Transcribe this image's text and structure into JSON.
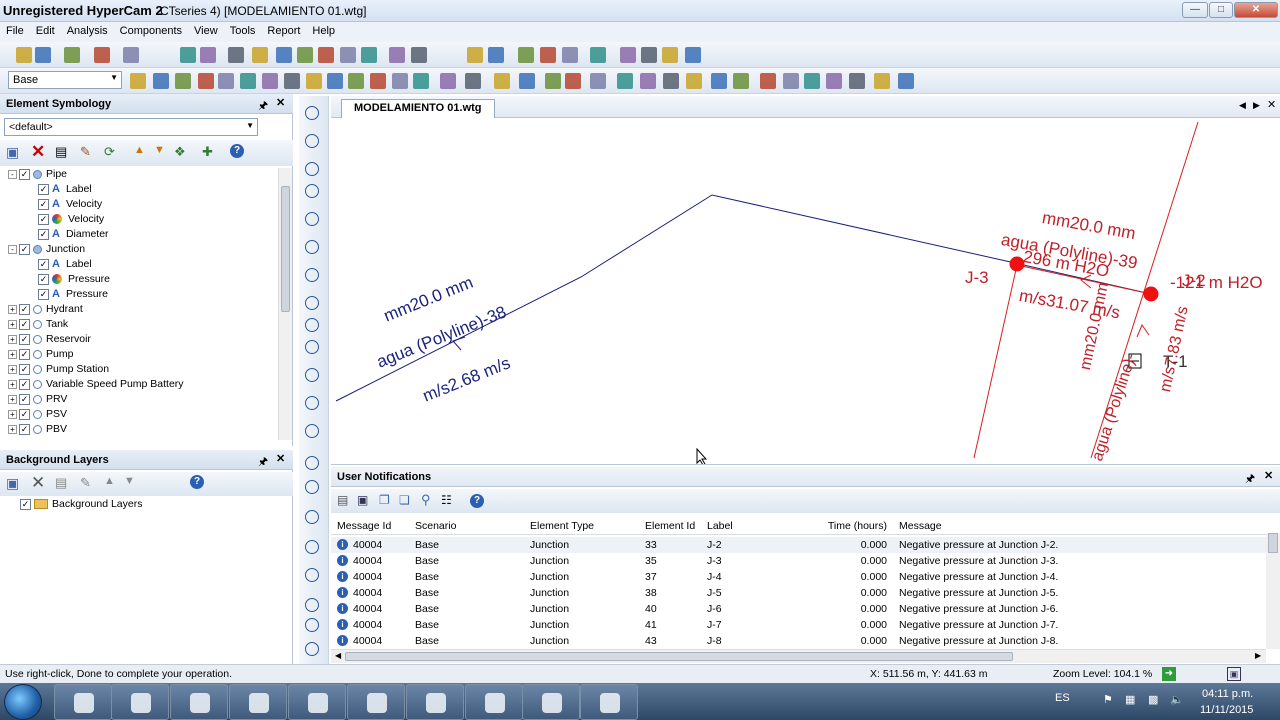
{
  "window": {
    "title_bold": "Unregistered HyperCam 2",
    "title_rest": "CTseries 4) [MODELAMIENTO 01.wtg]"
  },
  "menu": [
    "File",
    "Edit",
    "Analysis",
    "Components",
    "View",
    "Tools",
    "Report",
    "Help"
  ],
  "scenario_select": "Base",
  "symbology": {
    "title": "Element Symbology",
    "dropdown": "<default>",
    "tree": [
      {
        "label": "Pipe",
        "level": 0,
        "exp": "-"
      },
      {
        "label": "Label",
        "level": 1,
        "icon": "A"
      },
      {
        "label": "Velocity",
        "level": 1,
        "icon": "A"
      },
      {
        "label": "Velocity",
        "level": 1,
        "icon": "color"
      },
      {
        "label": "Diameter",
        "level": 1,
        "icon": "A"
      },
      {
        "label": "Junction",
        "level": 0,
        "exp": "-"
      },
      {
        "label": "Label",
        "level": 1,
        "icon": "A"
      },
      {
        "label": "Pressure",
        "level": 1,
        "icon": "color"
      },
      {
        "label": "Pressure",
        "level": 1,
        "icon": "A"
      },
      {
        "label": "Hydrant",
        "level": 0,
        "exp": "+"
      },
      {
        "label": "Tank",
        "level": 0,
        "exp": "+"
      },
      {
        "label": "Reservoir",
        "level": 0,
        "exp": "+"
      },
      {
        "label": "Pump",
        "level": 0,
        "exp": "+"
      },
      {
        "label": "Pump Station",
        "level": 0,
        "exp": "+"
      },
      {
        "label": "Variable Speed Pump Battery",
        "level": 0,
        "exp": "+"
      },
      {
        "label": "PRV",
        "level": 0,
        "exp": "+"
      },
      {
        "label": "PSV",
        "level": 0,
        "exp": "+"
      },
      {
        "label": "PBV",
        "level": 0,
        "exp": "+"
      }
    ]
  },
  "background": {
    "title": "Background Layers",
    "item": "Background Layers"
  },
  "drawing": {
    "tab": "MODELAMIENTO 01.wtg",
    "labels": {
      "left_diam": "mm20.0 mm",
      "left_pipe": "agua (Polyline)-38",
      "left_vel": "m/s2.68 m/s",
      "j3": "J-3",
      "r_diam": "mm20.0 mm",
      "r_pipe": "agua (Polyline)-39",
      "r_press": "296 m H2O",
      "r_vel": "m/s31.07 m/s",
      "r_press2": "-121 m H2O",
      "j2": "J-2",
      "t1": "T-1",
      "v_diam": "mm20.0 mm",
      "v_pipe": "agua (Polyline)-",
      "v_vel": "m/s7.83 m/s"
    }
  },
  "notifications": {
    "title": "User Notifications",
    "columns": [
      "Message Id",
      "Scenario",
      "Element Type",
      "Element Id",
      "Label",
      "Time (hours)",
      "Message"
    ],
    "rows": [
      [
        "40004",
        "Base",
        "Junction",
        "33",
        "J-2",
        "0.000",
        "Negative pressure at Junction J-2."
      ],
      [
        "40004",
        "Base",
        "Junction",
        "35",
        "J-3",
        "0.000",
        "Negative pressure at Junction J-3."
      ],
      [
        "40004",
        "Base",
        "Junction",
        "37",
        "J-4",
        "0.000",
        "Negative pressure at Junction J-4."
      ],
      [
        "40004",
        "Base",
        "Junction",
        "38",
        "J-5",
        "0.000",
        "Negative pressure at Junction J-5."
      ],
      [
        "40004",
        "Base",
        "Junction",
        "40",
        "J-6",
        "0.000",
        "Negative pressure at Junction J-6."
      ],
      [
        "40004",
        "Base",
        "Junction",
        "41",
        "J-7",
        "0.000",
        "Negative pressure at Junction J-7."
      ],
      [
        "40004",
        "Base",
        "Junction",
        "43",
        "J-8",
        "0.000",
        "Negative pressure at Junction J-8."
      ]
    ]
  },
  "status": {
    "hint": "Use right-click, Done to complete your operation.",
    "coords": "X: 511.56 m, Y: 441.63 m",
    "zoom": "Zoom Level: 104.1 %"
  },
  "taskbar": {
    "lang": "ES",
    "time": "04:11 p.m.",
    "date": "11/11/2015"
  },
  "colors": {
    "pipe_blue": "#1a1f7a",
    "pipe_red": "#d81e1e",
    "label_red": "#c0202a",
    "label_blue": "#1a237e"
  }
}
